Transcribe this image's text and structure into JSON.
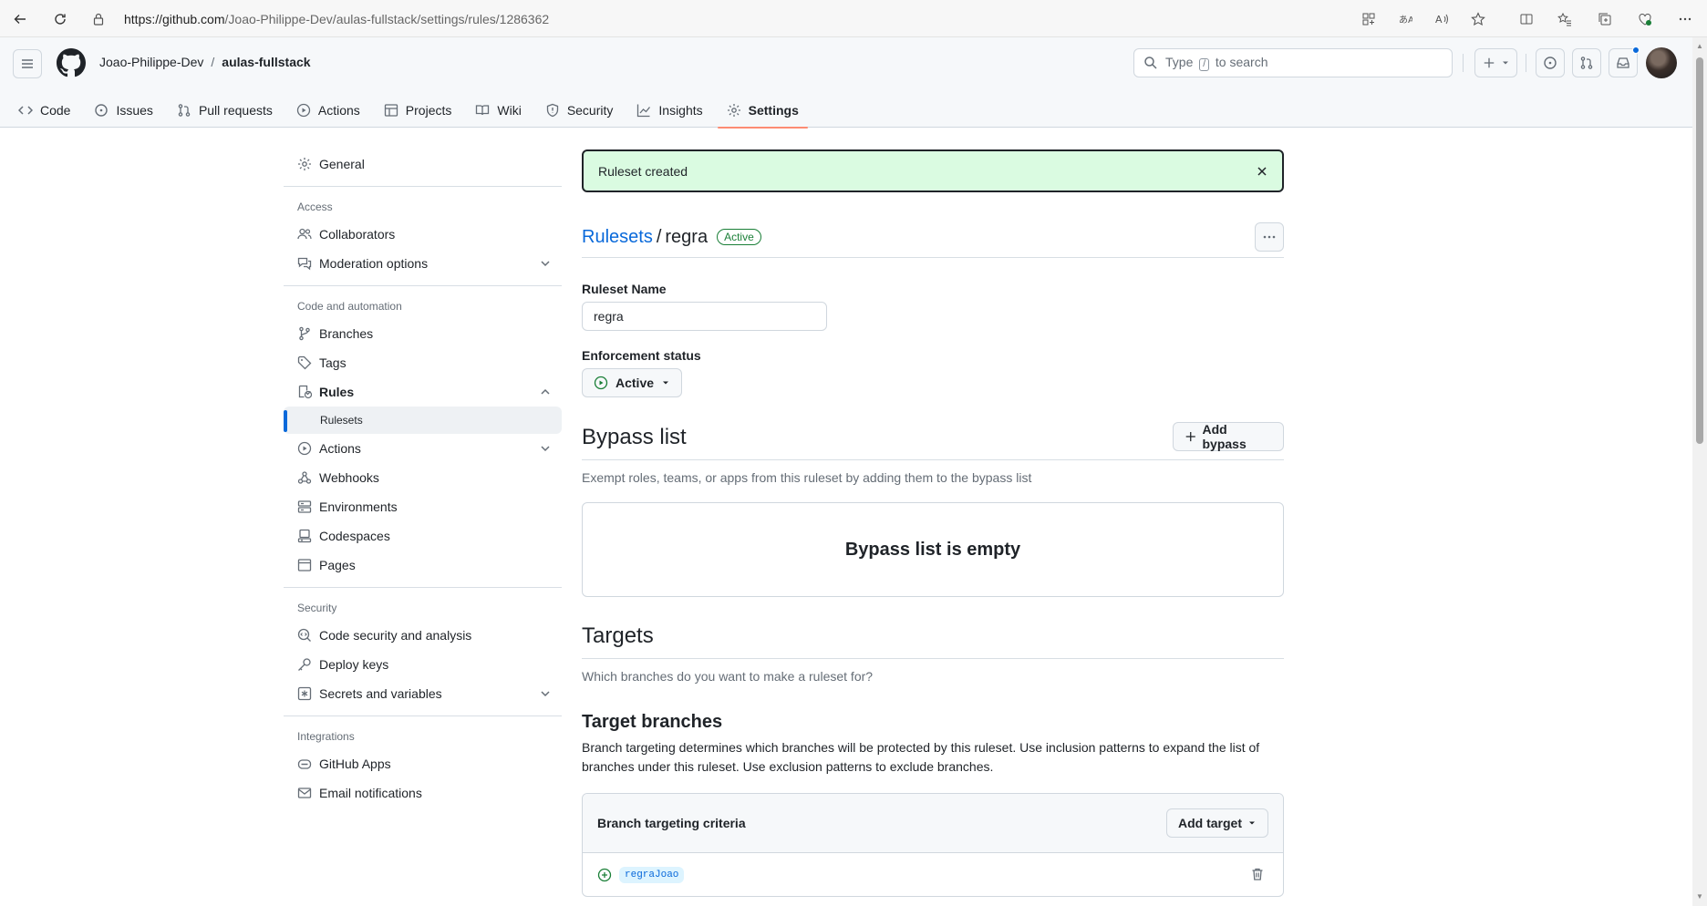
{
  "browser": {
    "url_host": "https://github.com",
    "url_path": "/Joao-Philippe-Dev/aulas-fullstack/settings/rules/1286362"
  },
  "header": {
    "owner": "Joao-Philippe-Dev",
    "separator": "/",
    "repo": "aulas-fullstack",
    "search_prefix": "Type",
    "search_key": "/",
    "search_suffix": "to search"
  },
  "tabs": [
    {
      "label": "Code",
      "icon": "code-icon"
    },
    {
      "label": "Issues",
      "icon": "issue-icon"
    },
    {
      "label": "Pull requests",
      "icon": "pull-request-icon"
    },
    {
      "label": "Actions",
      "icon": "play-icon"
    },
    {
      "label": "Projects",
      "icon": "table-icon"
    },
    {
      "label": "Wiki",
      "icon": "book-icon"
    },
    {
      "label": "Security",
      "icon": "shield-icon"
    },
    {
      "label": "Insights",
      "icon": "graph-icon"
    },
    {
      "label": "Settings",
      "icon": "gear-icon",
      "active": true
    }
  ],
  "sidebar": {
    "general": "General",
    "access_heading": "Access",
    "collaborators": "Collaborators",
    "moderation": "Moderation options",
    "code_heading": "Code and automation",
    "branches": "Branches",
    "tags": "Tags",
    "rules": "Rules",
    "rulesets": "Rulesets",
    "actions": "Actions",
    "webhooks": "Webhooks",
    "environments": "Environments",
    "codespaces": "Codespaces",
    "pages": "Pages",
    "security_heading": "Security",
    "code_security": "Code security and analysis",
    "deploy_keys": "Deploy keys",
    "secrets": "Secrets and variables",
    "integrations_heading": "Integrations",
    "github_apps": "GitHub Apps",
    "email_notifications": "Email notifications"
  },
  "main": {
    "flash": "Ruleset created",
    "crumb_link": "Rulesets",
    "crumb_sep": "/",
    "crumb_current": "regra",
    "status_badge": "Active",
    "name_label": "Ruleset Name",
    "name_value": "regra",
    "enforcement_label": "Enforcement status",
    "enforcement_value": "Active",
    "bypass_title": "Bypass list",
    "add_bypass": "Add bypass",
    "bypass_desc": "Exempt roles, teams, or apps from this ruleset by adding them to the bypass list",
    "bypass_empty": "Bypass list is empty",
    "targets_title": "Targets",
    "targets_desc": "Which branches do you want to make a ruleset for?",
    "target_branches_title": "Target branches",
    "target_branches_desc": "Branch targeting determines which branches will be protected by this ruleset. Use inclusion patterns to expand the list of branches under this ruleset. Use exclusion patterns to exclude branches.",
    "criteria_title": "Branch targeting criteria",
    "add_target": "Add target",
    "pattern": "regraJoao"
  },
  "colors": {
    "accent": "#0969da",
    "success": "#1a7f37",
    "flash_bg": "#dafbe1",
    "tab_underline": "#fd8c73"
  }
}
